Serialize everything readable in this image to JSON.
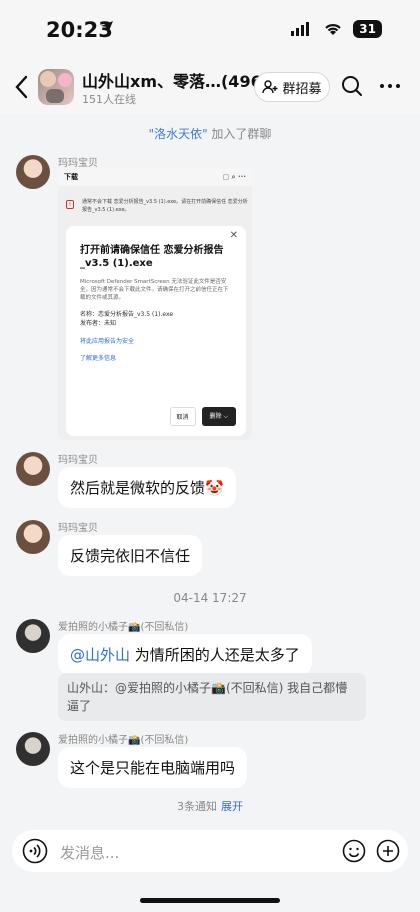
{
  "status_bar": {
    "time": "20:23",
    "battery": "31"
  },
  "header": {
    "title": "山外山xm、零落…(496)",
    "online": "151人在线",
    "recruit_label": "群招募"
  },
  "system_join": {
    "name": "\"洛水天依\"",
    "text": "加入了群聊"
  },
  "messages": [
    {
      "sender": "玛玛宝贝",
      "type": "image"
    },
    {
      "sender": "玛玛宝贝",
      "text": "然后就是微软的反馈🤡"
    },
    {
      "sender": "玛玛宝贝",
      "text": "反馈完依旧不信任"
    },
    {
      "timestamp": "04-14 17:27"
    },
    {
      "sender": "爱拍照的小橘子📸(不回私信)",
      "mention": "@山外山",
      "text": " 为情所困的人还是太多了",
      "quote": "山外山：@爱拍照的小橘子📸(不回私信) 我自己都懵逼了"
    },
    {
      "sender": "爱拍照的小橘子📸(不回私信)",
      "text": "这个是只能在电脑端用吗"
    }
  ],
  "screenshot": {
    "top_title": "下载",
    "warn": "通常不会下载 恋爱分析报告_v3.5 (1).exe。请在打开前确保信任 恋爱分析报告_v3.5 (1).exe。",
    "dialog_title": "打开前请确保信任 恋爱分析报告_v3.5 (1).exe",
    "dialog_body": "Microsoft Defender SmartScreen 无法验证此文件是否安全，因为通常不会下载此文件。请确保在打开之前信任正在下载的文件或其源。",
    "name_line": "名称：恋爱分析报告_v3.5 (1).exe",
    "publisher_line": "发布者：未知",
    "link_report": "将此应用报告为安全",
    "link_more": "了解更多信息",
    "btn_cancel": "取消",
    "btn_delete": "删除"
  },
  "notice": {
    "text": "3条通知",
    "expand": "展开"
  },
  "input": {
    "placeholder": "发消息..."
  },
  "colors": {
    "accent": "#2e6fd1",
    "background": "#f3f4f6"
  }
}
